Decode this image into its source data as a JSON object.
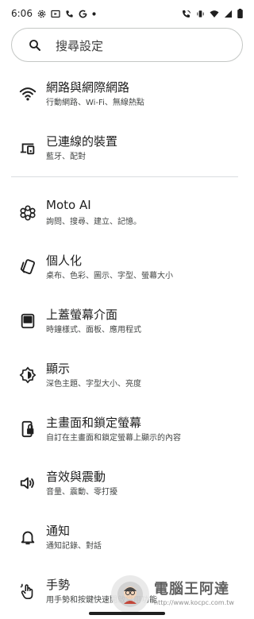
{
  "status_bar": {
    "time": "6:06",
    "left_icons": [
      "settings-icon",
      "media-icon",
      "phone-icon",
      "google-g-icon",
      "dot-icon"
    ],
    "right_icons": [
      "wifi-calling-icon",
      "vibrate-icon",
      "wifi-icon",
      "signal-icon",
      "battery-icon"
    ]
  },
  "search": {
    "placeholder": "搜尋設定"
  },
  "items": [
    {
      "title": "網路與網際網路",
      "subtitle": "行動網路、Wi-Fi、無線熱點",
      "icon": "wifi-icon"
    },
    {
      "title": "已連線的裝置",
      "subtitle": "藍牙、配對",
      "icon": "devices-icon"
    },
    {
      "title": "Moto AI",
      "subtitle": "詢問、搜尋、建立、記憶。",
      "icon": "moto-ai-icon"
    },
    {
      "title": "個人化",
      "subtitle": "桌布、色彩、圖示、字型、螢幕大小",
      "icon": "personalize-icon"
    },
    {
      "title": "上蓋螢幕介面",
      "subtitle": "時鐘樣式、面板、應用程式",
      "icon": "cover-screen-icon"
    },
    {
      "title": "顯示",
      "subtitle": "深色主題、字型大小、亮度",
      "icon": "display-icon"
    },
    {
      "title": "主畫面和鎖定螢幕",
      "subtitle": "自訂在主畫面和鎖定螢幕上顯示的內容",
      "icon": "lock-screen-icon"
    },
    {
      "title": "音效與震動",
      "subtitle": "音量、震動、零打擾",
      "icon": "sound-icon"
    },
    {
      "title": "通知",
      "subtitle": "通知記錄、對話",
      "icon": "bell-icon"
    },
    {
      "title": "手勢",
      "subtitle": "用手勢和按鍵快速開啟常用功能",
      "icon": "gesture-icon"
    }
  ],
  "watermark": {
    "text": "電腦王阿達",
    "url": "http://www.kocpc.com.tw"
  }
}
